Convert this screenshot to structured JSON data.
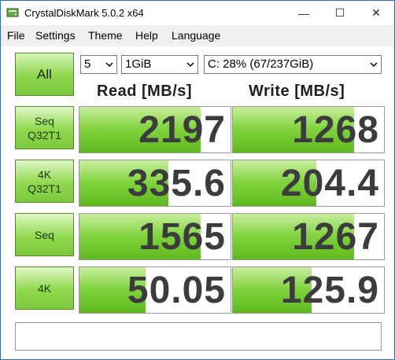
{
  "window": {
    "title": "CrystalDiskMark 5.0.2 x64",
    "minimize_glyph": "—",
    "maximize_glyph": "☐",
    "close_glyph": "✕"
  },
  "menu": [
    "File",
    "Settings",
    "Theme",
    "Help",
    "Language"
  ],
  "controls": {
    "all_label": "All",
    "runs": "5",
    "size": "1GiB",
    "drive": "C: 28% (67/237GiB)"
  },
  "headers": {
    "read": "Read [MB/s]",
    "write": "Write [MB/s]"
  },
  "rows": [
    {
      "label1": "Seq",
      "label2": "Q32T1",
      "read": "2197",
      "write": "1268",
      "read_fill": 0.8,
      "write_fill": 0.8
    },
    {
      "label1": "4K",
      "label2": "Q32T1",
      "read": "335.6",
      "write": "204.4",
      "read_fill": 0.59,
      "write_fill": 0.55
    },
    {
      "label1": "Seq",
      "label2": "",
      "read": "1565",
      "write": "1267",
      "read_fill": 0.8,
      "write_fill": 0.8
    },
    {
      "label1": "4K",
      "label2": "",
      "read": "50.05",
      "write": "125.9",
      "read_fill": 0.44,
      "write_fill": 0.52
    }
  ],
  "comment": ""
}
